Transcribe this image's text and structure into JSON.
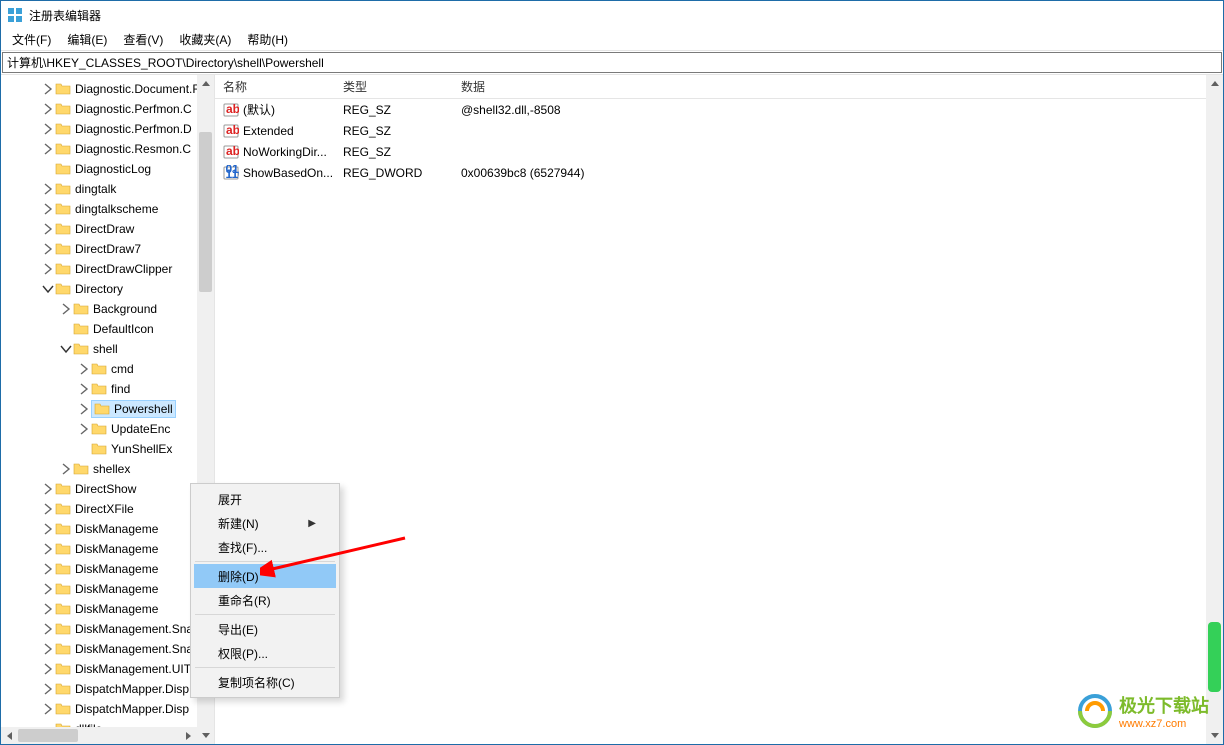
{
  "window": {
    "title": "注册表编辑器"
  },
  "menubar": [
    {
      "label": "文件(F)"
    },
    {
      "label": "编辑(E)"
    },
    {
      "label": "查看(V)"
    },
    {
      "label": "收藏夹(A)"
    },
    {
      "label": "帮助(H)"
    }
  ],
  "address": "计算机\\HKEY_CLASSES_ROOT\\Directory\\shell\\Powershell",
  "tree": [
    {
      "indent": 2,
      "chev": ">",
      "label": "Diagnostic.Document.F"
    },
    {
      "indent": 2,
      "chev": ">",
      "label": "Diagnostic.Perfmon.C"
    },
    {
      "indent": 2,
      "chev": ">",
      "label": "Diagnostic.Perfmon.D"
    },
    {
      "indent": 2,
      "chev": ">",
      "label": "Diagnostic.Resmon.C"
    },
    {
      "indent": 2,
      "chev": "",
      "label": "DiagnosticLog"
    },
    {
      "indent": 2,
      "chev": ">",
      "label": "dingtalk"
    },
    {
      "indent": 2,
      "chev": ">",
      "label": "dingtalkscheme"
    },
    {
      "indent": 2,
      "chev": ">",
      "label": "DirectDraw"
    },
    {
      "indent": 2,
      "chev": ">",
      "label": "DirectDraw7"
    },
    {
      "indent": 2,
      "chev": ">",
      "label": "DirectDrawClipper"
    },
    {
      "indent": 2,
      "chev": "v",
      "label": "Directory"
    },
    {
      "indent": 3,
      "chev": ">",
      "label": "Background"
    },
    {
      "indent": 3,
      "chev": "",
      "label": "DefaultIcon"
    },
    {
      "indent": 3,
      "chev": "v",
      "label": "shell"
    },
    {
      "indent": 4,
      "chev": ">",
      "label": "cmd"
    },
    {
      "indent": 4,
      "chev": ">",
      "label": "find"
    },
    {
      "indent": 4,
      "chev": ">",
      "label": "Powershell",
      "selected": true
    },
    {
      "indent": 4,
      "chev": ">",
      "label": "UpdateEnc"
    },
    {
      "indent": 4,
      "chev": "",
      "label": "YunShellEx"
    },
    {
      "indent": 3,
      "chev": ">",
      "label": "shellex"
    },
    {
      "indent": 2,
      "chev": ">",
      "label": "DirectShow"
    },
    {
      "indent": 2,
      "chev": ">",
      "label": "DirectXFile"
    },
    {
      "indent": 2,
      "chev": ">",
      "label": "DiskManageme"
    },
    {
      "indent": 2,
      "chev": ">",
      "label": "DiskManageme"
    },
    {
      "indent": 2,
      "chev": ">",
      "label": "DiskManageme"
    },
    {
      "indent": 2,
      "chev": ">",
      "label": "DiskManageme"
    },
    {
      "indent": 2,
      "chev": ">",
      "label": "DiskManageme"
    },
    {
      "indent": 2,
      "chev": ">",
      "label": "DiskManagement.Sna"
    },
    {
      "indent": 2,
      "chev": ">",
      "label": "DiskManagement.Sna"
    },
    {
      "indent": 2,
      "chev": ">",
      "label": "DiskManagement.UIT"
    },
    {
      "indent": 2,
      "chev": ">",
      "label": "DispatchMapper.Disp"
    },
    {
      "indent": 2,
      "chev": ">",
      "label": "DispatchMapper.Disp"
    },
    {
      "indent": 2,
      "chev": "",
      "label": "dllfile"
    }
  ],
  "list": {
    "columns": {
      "name": "名称",
      "type": "类型",
      "data": "数据"
    },
    "rows": [
      {
        "iconType": "sz",
        "name": "(默认)",
        "type": "REG_SZ",
        "data": "@shell32.dll,-8508"
      },
      {
        "iconType": "sz",
        "name": "Extended",
        "type": "REG_SZ",
        "data": ""
      },
      {
        "iconType": "sz",
        "name": "NoWorkingDir...",
        "type": "REG_SZ",
        "data": ""
      },
      {
        "iconType": "bin",
        "name": "ShowBasedOn...",
        "type": "REG_DWORD",
        "data": "0x00639bc8 (6527944)"
      }
    ]
  },
  "contextMenu": [
    {
      "label": "展开",
      "kind": "item"
    },
    {
      "label": "新建(N)",
      "kind": "submenu"
    },
    {
      "label": "查找(F)...",
      "kind": "item"
    },
    {
      "kind": "sep"
    },
    {
      "label": "删除(D)",
      "kind": "item",
      "hover": true
    },
    {
      "label": "重命名(R)",
      "kind": "item"
    },
    {
      "kind": "sep"
    },
    {
      "label": "导出(E)",
      "kind": "item"
    },
    {
      "label": "权限(P)...",
      "kind": "item"
    },
    {
      "kind": "sep"
    },
    {
      "label": "复制项名称(C)",
      "kind": "item"
    }
  ],
  "watermark": {
    "line1": "极光下载站",
    "line2": "www.xz7.com"
  }
}
